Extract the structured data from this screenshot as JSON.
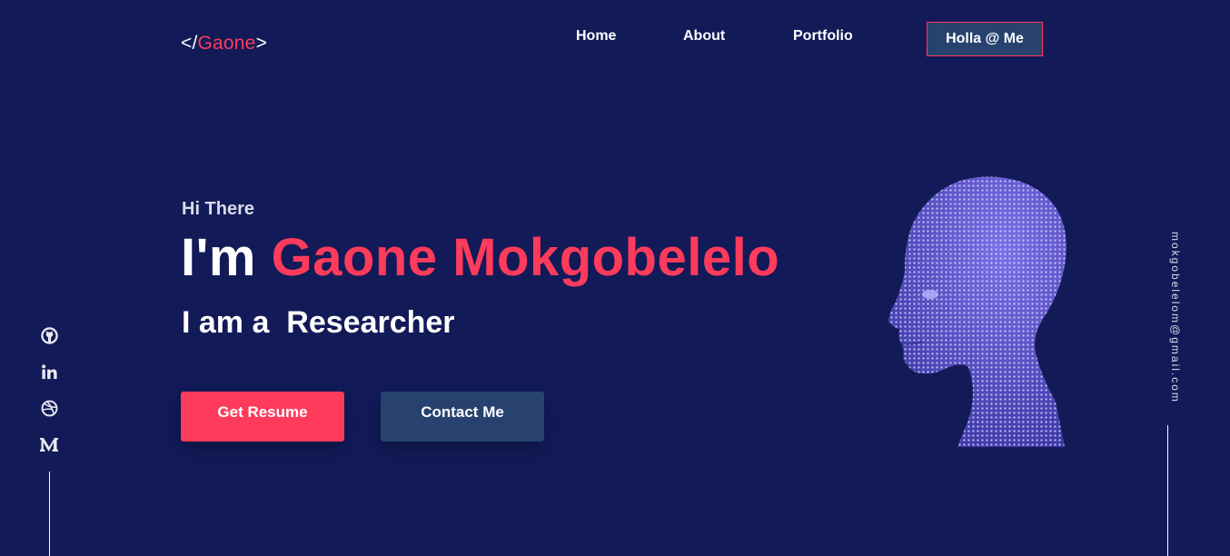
{
  "header": {
    "logo": {
      "prefix": "</",
      "name": "Gaone",
      "suffix": ">"
    },
    "nav": [
      {
        "label": "Home"
      },
      {
        "label": "About"
      },
      {
        "label": "Portfolio"
      }
    ],
    "cta_label": "Holla @ Me"
  },
  "hero": {
    "greeting": "Hi There",
    "headline_prefix": "I'm ",
    "headline_name": "Gaone Mokgobelelo",
    "role_prefix": "I am a ",
    "role": "Researcher",
    "primary_button": "Get Resume",
    "secondary_button": "Contact Me"
  },
  "socials": [
    {
      "icon": "github-icon"
    },
    {
      "icon": "linkedin-icon"
    },
    {
      "icon": "dribbble-icon"
    },
    {
      "icon": "medium-icon"
    }
  ],
  "contact": {
    "email": "mokgobelelom@gmail.com"
  },
  "colors": {
    "background": "#121a58",
    "accent": "#ff3b5c",
    "secondary": "#27426e",
    "illustration": "#6c63d8"
  }
}
